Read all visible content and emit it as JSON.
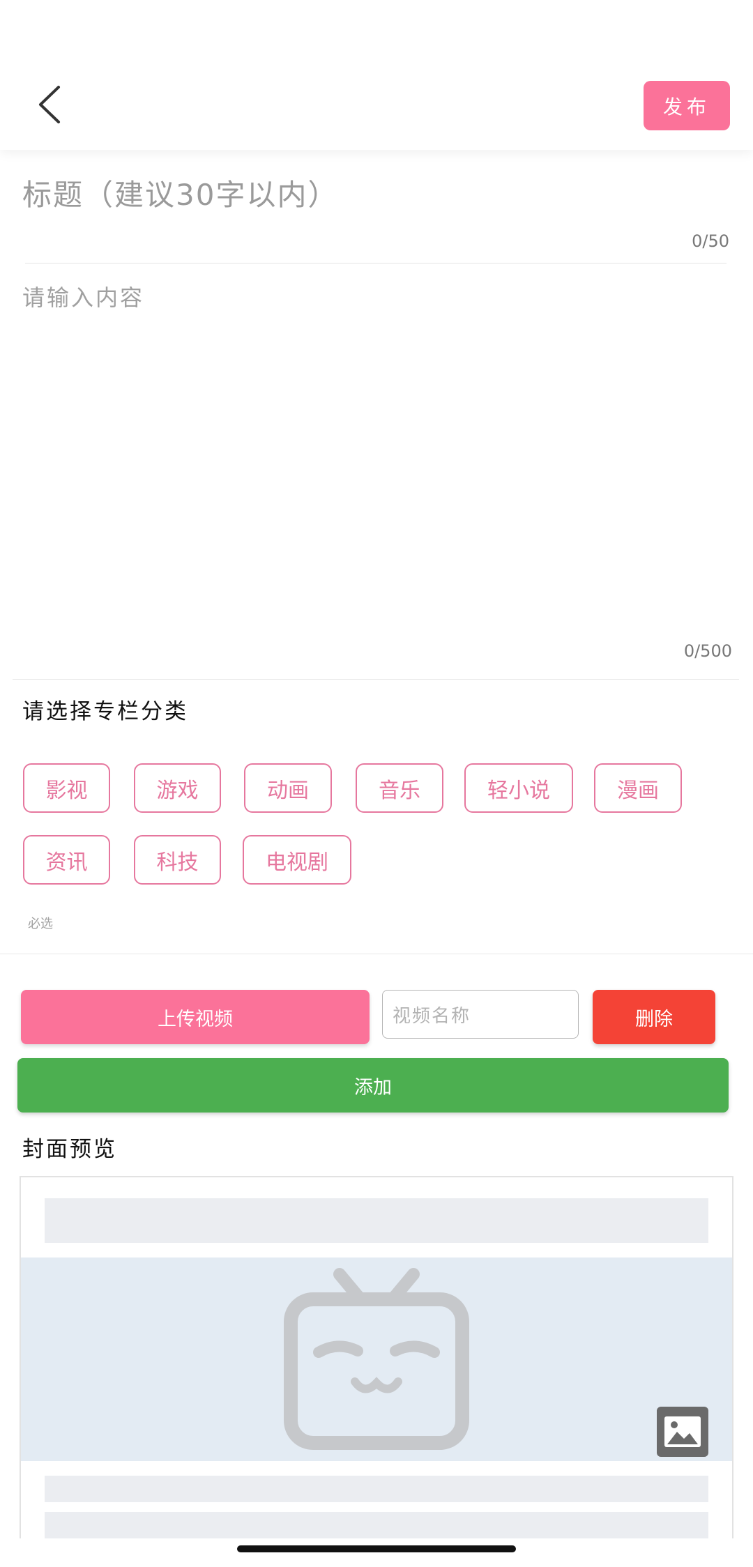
{
  "header": {
    "publish_label": "发布"
  },
  "editor": {
    "title_placeholder": "标题（建议30字以内）",
    "title_counter": "0/50",
    "content_placeholder": "请输入内容",
    "content_counter": "0/500"
  },
  "category": {
    "label": "请选择专栏分类",
    "tags": [
      "影视",
      "游戏",
      "动画",
      "音乐",
      "轻小说",
      "漫画",
      "资讯",
      "科技",
      "电视剧"
    ],
    "hint": "必选"
  },
  "video": {
    "upload_label": "上传视频",
    "name_placeholder": "视频名称",
    "delete_label": "删除",
    "add_label": "添加"
  },
  "cover": {
    "label": "封面预览"
  },
  "colors": {
    "brand_pink": "#fb7299",
    "tag_pink": "#e6779e",
    "delete_red": "#f44336",
    "add_green": "#4caf50"
  },
  "icons": {
    "back": "chevron-left-icon",
    "placeholder": "tv-mascot-icon",
    "image_picker": "image-icon"
  }
}
